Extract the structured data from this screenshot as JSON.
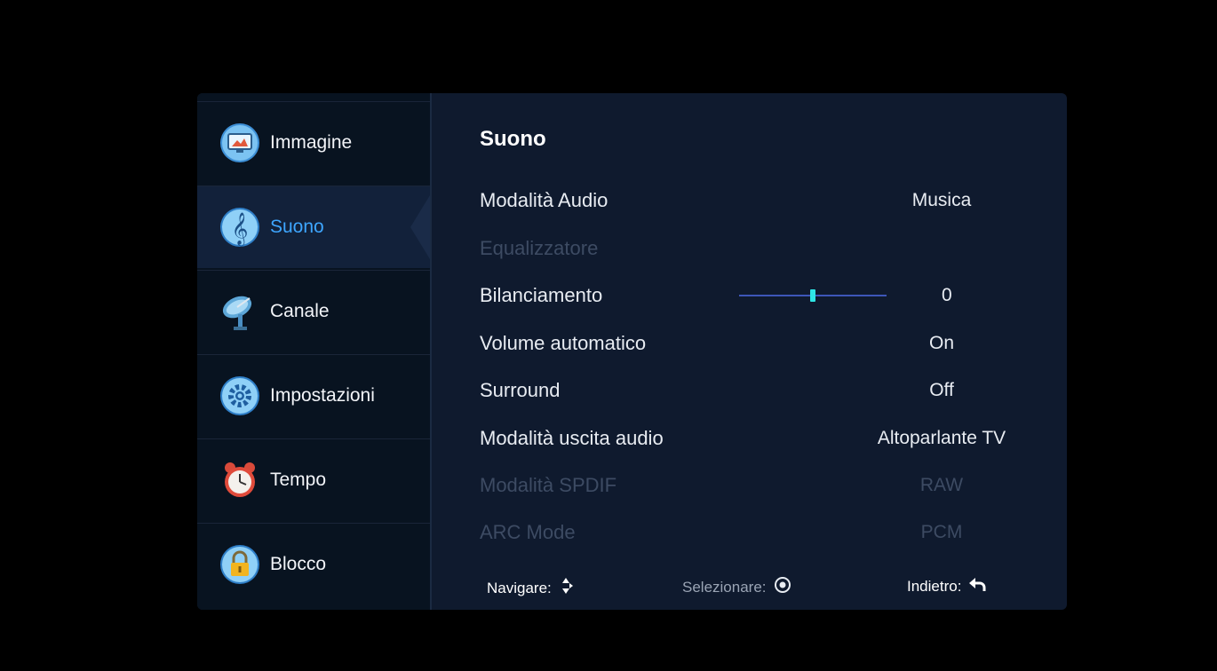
{
  "sidebar": {
    "items": [
      {
        "label": "Immagine",
        "icon": "picture-monitor-icon"
      },
      {
        "label": "Suono",
        "icon": "music-note-icon",
        "active": true
      },
      {
        "label": "Canale",
        "icon": "satellite-dish-icon"
      },
      {
        "label": "Impostazioni",
        "icon": "gear-icon"
      },
      {
        "label": "Tempo",
        "icon": "alarm-clock-icon"
      },
      {
        "label": "Blocco",
        "icon": "padlock-icon"
      }
    ]
  },
  "main": {
    "title": "Suono",
    "rows": [
      {
        "label": "Modalità Audio",
        "value": "Musica"
      },
      {
        "label": "Equalizzatore",
        "value": "",
        "disabled": true
      },
      {
        "label": "Bilanciamento",
        "value": "0",
        "slider_fraction": 0.5
      },
      {
        "label": "Volume automatico",
        "value": "On"
      },
      {
        "label": "Surround",
        "value": "Off"
      },
      {
        "label": "Modalità uscita audio",
        "value": "Altoparlante TV"
      },
      {
        "label": "Modalità SPDIF",
        "value": "RAW",
        "disabled": true
      },
      {
        "label": "ARC Mode",
        "value": "PCM",
        "disabled": true
      }
    ]
  },
  "footer": {
    "navigate": "Navigare:",
    "select": "Selezionare:",
    "back": "Indietro:"
  },
  "colors": {
    "accent": "#3ea6ff",
    "slider_thumb": "#2ee5e5",
    "panel_bg": "#0f1a2e",
    "sidebar_bg": "#081320"
  }
}
